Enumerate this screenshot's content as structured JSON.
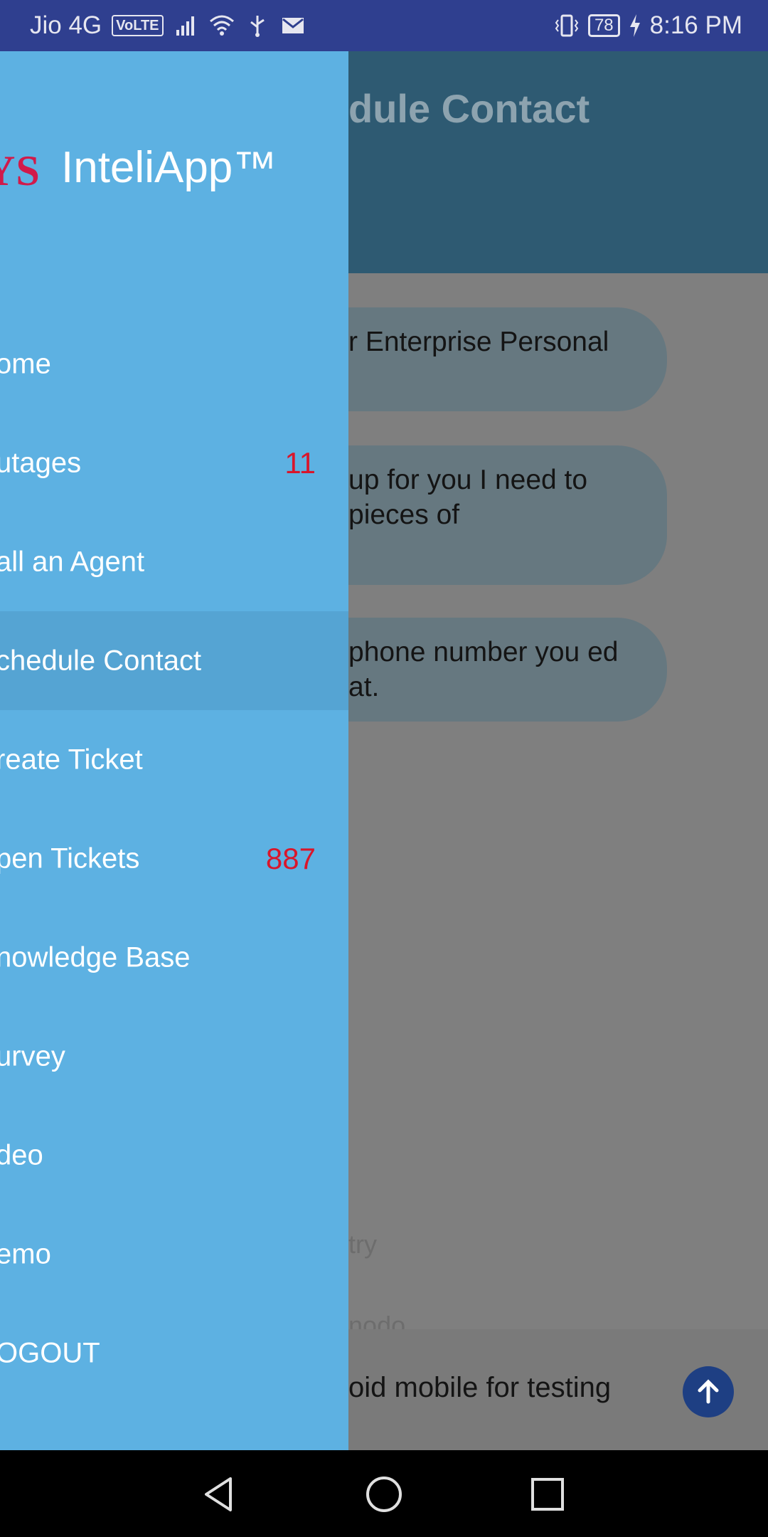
{
  "status_bar": {
    "carrier": "Jio 4G",
    "volte": "VoLTE",
    "battery": "78",
    "time": "8:16 PM"
  },
  "background": {
    "title": "dule Contact",
    "messages": [
      "r Enterprise Personal",
      "up for you I need to pieces of",
      "phone number you ed at."
    ],
    "faded_1": "ntry",
    "faded_2": "onodo",
    "input_text": "oid mobile  for testing"
  },
  "drawer": {
    "logo_mark": "YS",
    "logo_text": "InteliApp™",
    "items": [
      {
        "label": "ome",
        "badge": ""
      },
      {
        "label": "utages",
        "badge": "11"
      },
      {
        "label": "all an Agent",
        "badge": ""
      },
      {
        "label": "chedule Contact",
        "badge": ""
      },
      {
        "label": "reate Ticket",
        "badge": ""
      },
      {
        "label": "pen Tickets",
        "badge": "887"
      },
      {
        "label": "nowledge Base",
        "badge": ""
      },
      {
        "label": "urvey",
        "badge": ""
      },
      {
        "label": "deo",
        "badge": ""
      },
      {
        "label": "emo",
        "badge": ""
      },
      {
        "label": "OGOUT",
        "badge": ""
      }
    ]
  }
}
